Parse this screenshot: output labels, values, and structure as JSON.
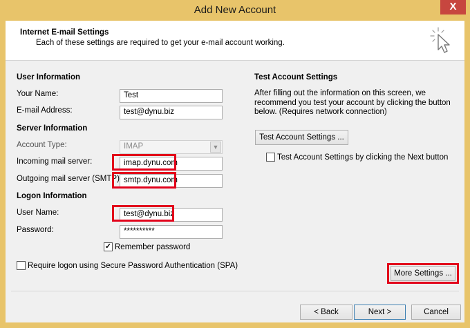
{
  "window": {
    "title": "Add New Account",
    "close_glyph": "X",
    "accent": "#e8c46a"
  },
  "header": {
    "title": "Internet E-mail Settings",
    "subtitle": "Each of these settings are required to get your e-mail account working."
  },
  "user_info": {
    "title": "User Information",
    "name_label": "Your Name:",
    "name_value": "Test",
    "email_label": "E-mail Address:",
    "email_value": "test@dynu.biz"
  },
  "server_info": {
    "title": "Server Information",
    "account_type_label": "Account Type:",
    "account_type_value": "IMAP",
    "incoming_label": "Incoming mail server:",
    "incoming_value": "imap.dynu.com",
    "outgoing_label": "Outgoing mail server (SMTP):",
    "outgoing_value": "smtp.dynu.com"
  },
  "logon_info": {
    "title": "Logon Information",
    "username_label": "User Name:",
    "username_value": "test@dynu.biz",
    "password_label": "Password:",
    "password_value": "**********",
    "remember_label": "Remember password",
    "remember_checked": true,
    "spa_label": "Require logon using Secure Password Authentication (SPA)",
    "spa_checked": false
  },
  "test_settings": {
    "title": "Test Account Settings",
    "description": "After filling out the information on this screen, we recommend you test your account by clicking the button below. (Requires network connection)",
    "button_label": "Test Account Settings ...",
    "checkbox_label": "Test Account Settings by clicking the Next button",
    "checkbox_checked": false
  },
  "more_settings_label": "More Settings ...",
  "footer": {
    "back_label": "< Back",
    "next_label": "Next >",
    "cancel_label": "Cancel"
  },
  "highlight_color": "#e2001a"
}
